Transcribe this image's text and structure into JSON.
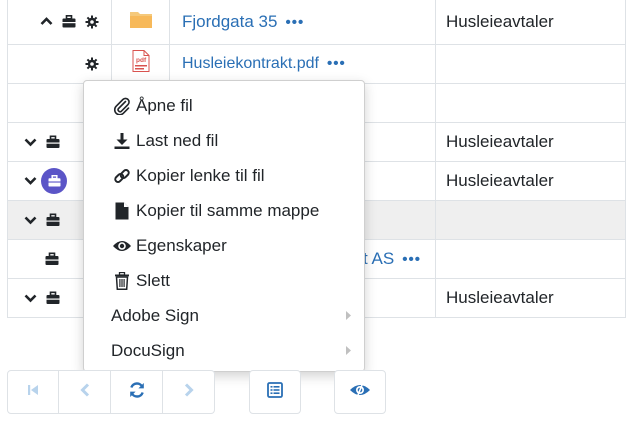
{
  "rows": [
    {
      "name": "Fjordgata 35",
      "type": "Husleieavtaler",
      "more": "•••"
    },
    {
      "name": "Husleiekontrakt.pdf",
      "type": "",
      "more": "•••"
    },
    {
      "name": "",
      "type": "",
      "more": "•••"
    },
    {
      "name": "",
      "type": "Husleieavtaler"
    },
    {
      "name": "",
      "type": "Husleieavtaler"
    },
    {
      "name": "",
      "type": ""
    },
    {
      "name": "t AS",
      "type": "",
      "more": "•••"
    },
    {
      "name": "",
      "type": "Husleieavtaler"
    }
  ],
  "pdf_badge": "pdf",
  "menu": {
    "items": [
      {
        "label": "Åpne fil",
        "icon": "paperclip-icon"
      },
      {
        "label": "Last ned fil",
        "icon": "download-icon"
      },
      {
        "label": "Kopier lenke til fil",
        "icon": "link-icon"
      },
      {
        "label": "Kopier til samme mappe",
        "icon": "file-icon"
      },
      {
        "label": "Egenskaper",
        "icon": "eye-icon"
      },
      {
        "label": "Slett",
        "icon": "trash-icon"
      },
      {
        "label": "Adobe Sign",
        "icon": "chevron-right-icon"
      },
      {
        "label": "DocuSign",
        "icon": "chevron-right-icon"
      }
    ]
  },
  "colors": {
    "link": "#2a6fb5",
    "accent": "#5b55c7",
    "muted": "#b8d3ec"
  }
}
